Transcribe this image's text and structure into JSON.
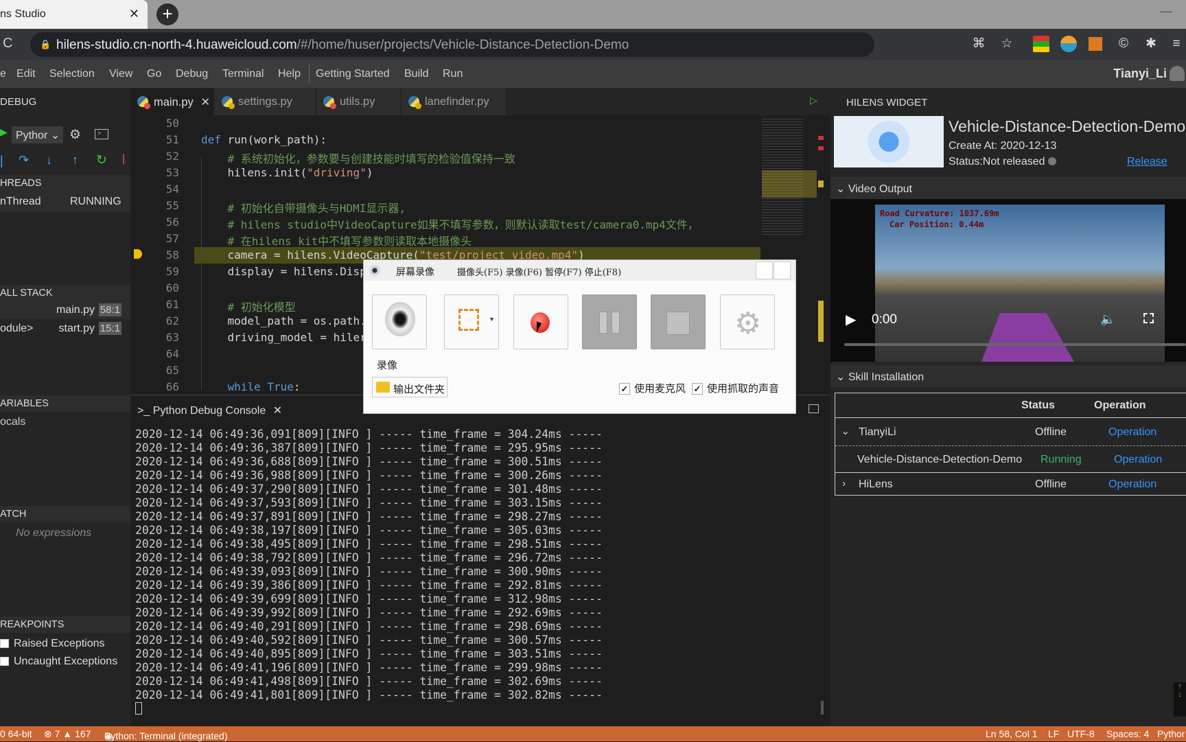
{
  "browser": {
    "tab_title": "ns Studio",
    "url_host": "hilens-studio.cn-north-4.huaweicloud.com",
    "url_path": "/#/home/huser/projects/Vehicle-Distance-Detection-Demo",
    "extension_icons": [
      "translate-icon",
      "star-icon",
      "download-extension-icon",
      "color-extension-icon",
      "orange-extension-icon",
      "circle-c-icon",
      "puzzle-icon",
      "media-icon"
    ]
  },
  "menu": {
    "items": [
      "e",
      "Edit",
      "Selection",
      "View",
      "Go",
      "Debug",
      "Terminal",
      "Help",
      "Getting Started",
      "Build",
      "Run"
    ],
    "user": "Tianyi_Li"
  },
  "sidebar": {
    "title": "DEBUG",
    "config": "Pythor",
    "threads_header": "HREADS",
    "thread_name": "nThread",
    "thread_status": "RUNNING",
    "callstack_header": "ALL STACK",
    "callstack": [
      {
        "name": "",
        "file": "main.py",
        "pos": "58:1"
      },
      {
        "name": "odule>",
        "file": "start.py",
        "pos": "15:1"
      }
    ],
    "variables_header": "ARIABLES",
    "locals": "ocals",
    "watch_header": "ATCH",
    "no_expressions": "No expressions",
    "breakpoints_header": "REAKPOINTS",
    "breakpoints": [
      "Raised Exceptions",
      "Uncaught Exceptions"
    ]
  },
  "editor": {
    "tabs": [
      {
        "label": "main.py",
        "badge": "#e05050",
        "active": true
      },
      {
        "label": "settings.py",
        "badge": "#d8b200",
        "active": false
      },
      {
        "label": "utils.py",
        "badge": "#e05050",
        "active": false
      },
      {
        "label": "lanefinder.py",
        "badge": "#d8b200",
        "active": false
      }
    ],
    "current_line": 58,
    "lines": [
      {
        "n": "50",
        "seg": []
      },
      {
        "n": "51",
        "seg": [
          [
            "def",
            "kw"
          ],
          [
            " run(work_path):",
            "pl"
          ]
        ]
      },
      {
        "n": "52",
        "seg": [
          [
            "    # 系统初始化，参数要与创建技能时填写的检验值保持一致",
            "cm"
          ]
        ]
      },
      {
        "n": "53",
        "seg": [
          [
            "    hilens.init(",
            "pl"
          ],
          [
            "\"driving\"",
            "str"
          ],
          [
            ")",
            "pl"
          ]
        ]
      },
      {
        "n": "54",
        "seg": []
      },
      {
        "n": "55",
        "seg": [
          [
            "    # 初始化自带摄像头与HDMI显示器,",
            "cm"
          ]
        ]
      },
      {
        "n": "56",
        "seg": [
          [
            "    # hilens studio中VideoCapture如果不填写参数，则默认读取test/camera0.mp4文件，",
            "cm"
          ]
        ]
      },
      {
        "n": "57",
        "seg": [
          [
            "    # 在hilens kit中不填写参数则读取本地摄像头",
            "cm"
          ]
        ]
      },
      {
        "n": "58",
        "seg": [
          [
            "    camera = hilens.VideoCapture(",
            "pl"
          ],
          [
            "\"test/project_video.mp4\"",
            "str"
          ],
          [
            ")",
            "pl"
          ]
        ]
      },
      {
        "n": "59",
        "seg": [
          [
            "    display = hilens.Disp",
            "pl"
          ]
        ]
      },
      {
        "n": "60",
        "seg": []
      },
      {
        "n": "61",
        "seg": [
          [
            "    # 初始化模型",
            "cm"
          ]
        ]
      },
      {
        "n": "62",
        "seg": [
          [
            "    model_path = os.path.",
            "pl"
          ]
        ]
      },
      {
        "n": "63",
        "seg": [
          [
            "    driving_model = hiler",
            "pl"
          ]
        ]
      },
      {
        "n": "64",
        "seg": []
      },
      {
        "n": "65",
        "seg": []
      },
      {
        "n": "66",
        "seg": [
          [
            "    ",
            "pl"
          ],
          [
            "while",
            "kw"
          ],
          [
            " ",
            "pl"
          ],
          [
            "True",
            "kw"
          ],
          [
            ":",
            "pl"
          ]
        ]
      }
    ]
  },
  "panel": {
    "tab": "Python Debug Console",
    "log": [
      [
        "2020-12-14 06:49:36,091",
        "304.24ms"
      ],
      [
        "2020-12-14 06:49:36,387",
        "295.95ms"
      ],
      [
        "2020-12-14 06:49:36,688",
        "300.51ms"
      ],
      [
        "2020-12-14 06:49:36,988",
        "300.26ms"
      ],
      [
        "2020-12-14 06:49:37,290",
        "301.48ms"
      ],
      [
        "2020-12-14 06:49:37,593",
        "303.15ms"
      ],
      [
        "2020-12-14 06:49:37,891",
        "298.27ms"
      ],
      [
        "2020-12-14 06:49:38,197",
        "305.03ms"
      ],
      [
        "2020-12-14 06:49:38,495",
        "298.51ms"
      ],
      [
        "2020-12-14 06:49:38,792",
        "296.72ms"
      ],
      [
        "2020-12-14 06:49:39,093",
        "300.90ms"
      ],
      [
        "2020-12-14 06:49:39,386",
        "292.81ms"
      ],
      [
        "2020-12-14 06:49:39,699",
        "312.98ms"
      ],
      [
        "2020-12-14 06:49:39,992",
        "292.69ms"
      ],
      [
        "2020-12-14 06:49:40,291",
        "298.69ms"
      ],
      [
        "2020-12-14 06:49:40,592",
        "300.57ms"
      ],
      [
        "2020-12-14 06:49:40,895",
        "303.51ms"
      ],
      [
        "2020-12-14 06:49:41,196",
        "299.98ms"
      ],
      [
        "2020-12-14 06:49:41,498",
        "302.69ms"
      ],
      [
        "2020-12-14 06:49:41,801",
        "302.82ms"
      ]
    ],
    "log_pid": "[809][INFO ] ----- time_frame = ",
    "log_tail": " -----"
  },
  "widget": {
    "header": "HILENS WIDGET",
    "title": "Vehicle-Distance-Detection-Demo(",
    "created": "Create At: 2020-12-13",
    "status": "Status:Not released",
    "release": "Release",
    "video_header": "Video Output",
    "overlay1": "Road Curvature: 1037.69m",
    "overlay2": "Car Position: 0.44m",
    "time": "0:00",
    "skill_header": "Skill Installation",
    "col_status": "Status",
    "col_operation": "Operation",
    "rows": [
      {
        "name": "TianyiLi",
        "status": "Offline",
        "op": "Operation",
        "expander": "v"
      },
      {
        "name": "Vehicle-Distance-Detection-Demo",
        "status": "Running",
        "op": "Operation",
        "expander": ""
      },
      {
        "name": "HiLens",
        "status": "Offline",
        "op": "Operation",
        "expander": ">"
      }
    ],
    "colors": {
      "running": "#3cb371",
      "link": "#3794ff"
    }
  },
  "dialog": {
    "title": "屏幕录像",
    "menu": "摄像头(F5) 录像(F6) 暂停(F7) 停止(F8)",
    "label": "录像",
    "folder_button": "输出文件夹",
    "mic": "使用麦克风",
    "capture_audio": "使用抓取的声音",
    "mic_checked": true,
    "capture_checked": true
  },
  "status": {
    "left": "0 64-bit",
    "errors": "7",
    "warnings": "167",
    "terminal": "Python: Terminal (integrated)",
    "pos": "Ln 58, Col 1",
    "eol": "LF",
    "enc": "UTF-8",
    "spaces": "Spaces: 4",
    "lang": "Pythor",
    "bg": "#cc6633"
  }
}
